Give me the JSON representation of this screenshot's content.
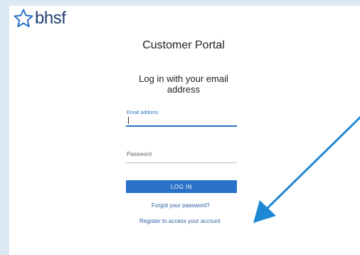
{
  "brand": {
    "name": "bhsf",
    "color": "#1f3f73"
  },
  "page": {
    "title": "Customer Portal",
    "subtitle": "Log in with your email address"
  },
  "form": {
    "email_label": "Email address",
    "email_value": "",
    "password_label": "Password",
    "password_value": "",
    "login_label": "LOG IN",
    "forgot_label": "Forgot your password?",
    "register_label": "Register to access your account"
  },
  "colors": {
    "accent": "#2a72c9",
    "annotation_arrow": "#1e87d6",
    "background": "#dce8f4"
  },
  "icons": {
    "logo": "star-outline-icon",
    "annotation": "arrow-icon"
  }
}
